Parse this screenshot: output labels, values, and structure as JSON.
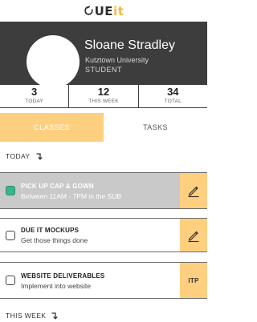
{
  "app": {
    "logo_prefix": "",
    "logo_main": "UE",
    "logo_accent": "it"
  },
  "profile": {
    "name": "Sloane Stradley",
    "school": "Kutztown University",
    "role": "STUDENT"
  },
  "stats": [
    {
      "value": "3",
      "label": "TODAY"
    },
    {
      "value": "12",
      "label": "THIS WEEK"
    },
    {
      "value": "34",
      "label": "TOTAL"
    }
  ],
  "tabs": {
    "classes": "CLASSES",
    "tasks": "TASKS",
    "active": "classes"
  },
  "sections": {
    "today": "TODAY",
    "this_week": "THIS WEEK"
  },
  "tasks": [
    {
      "title": "PICK UP CAP & GOWN",
      "subtitle": "Between 11AM - 7PM in the SUB",
      "completed": true,
      "action": "edit-icon"
    },
    {
      "title": "DUE IT MOCKUPS",
      "subtitle": "Get those things done",
      "completed": false,
      "action": "edit-icon"
    },
    {
      "title": "WEBSITE DELIVERABLES",
      "subtitle": "Implement into website",
      "completed": false,
      "action_label": "ITP"
    }
  ],
  "colors": {
    "accent": "#ffcf80",
    "header_bg": "#3d3d3d",
    "checked": "#3cb38c",
    "completed_row": "#c9c9c9"
  }
}
